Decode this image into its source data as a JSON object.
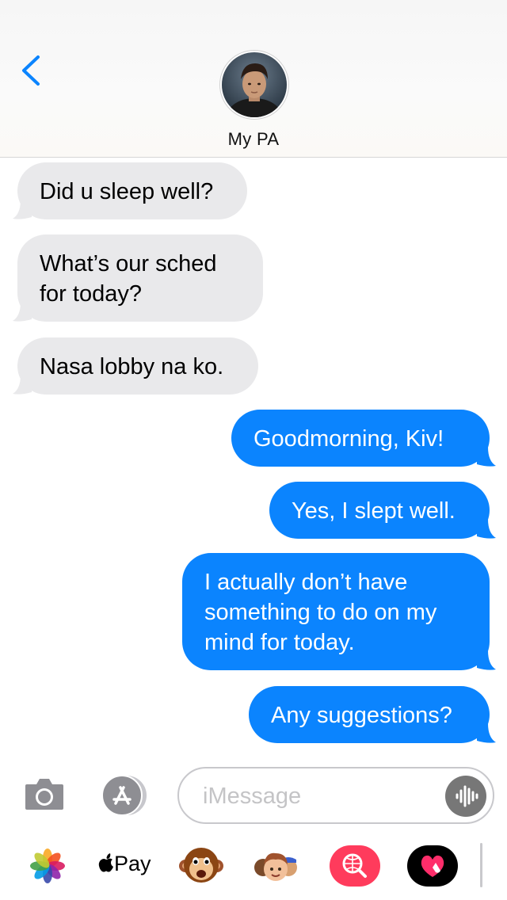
{
  "header": {
    "contact_name": "My PA",
    "back_icon": "chevron-left-icon"
  },
  "messages": [
    {
      "direction": "incoming",
      "lines": [
        "Did u sleep well?"
      ]
    },
    {
      "direction": "incoming",
      "lines": [
        "What’s our sched",
        "for today?"
      ]
    },
    {
      "direction": "incoming",
      "lines": [
        "Nasa lobby na ko."
      ]
    },
    {
      "direction": "outgoing",
      "lines": [
        "Goodmorning, Kiv!"
      ]
    },
    {
      "direction": "outgoing",
      "lines": [
        "Yes, I slept well."
      ]
    },
    {
      "direction": "outgoing",
      "lines": [
        "I actually don’t have",
        "something to do on my",
        "mind for today."
      ]
    },
    {
      "direction": "outgoing",
      "lines": [
        "Any suggestions?"
      ]
    }
  ],
  "composer": {
    "placeholder": "iMessage",
    "value": "",
    "camera_icon": "camera-icon",
    "appstore_icon": "app-store-icon",
    "audio_icon": "waveform-icon"
  },
  "app_tray": {
    "apple_pay_label": "Pay",
    "items": [
      "photos-icon",
      "apple-pay-icon",
      "monkey-animoji-icon",
      "memoji-stickers-icon",
      "web-images-search-icon",
      "digital-touch-icon"
    ]
  },
  "colors": {
    "outgoing_bubble": "#0b84fe",
    "incoming_bubble": "#e9e9eb",
    "accent": "#0b84fe"
  }
}
